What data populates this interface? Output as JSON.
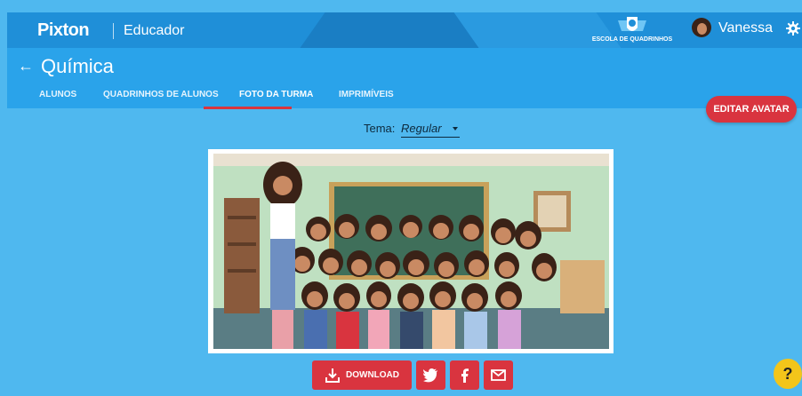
{
  "header": {
    "logo": "Pixton",
    "product": "Educador",
    "school_label": "ESCOLA DE QUADRINHOS",
    "user_name": "Vanessa"
  },
  "class": {
    "back_icon": "back-arrow-icon",
    "title": "Química"
  },
  "tabs": [
    {
      "label": "ALUNOS",
      "active": false
    },
    {
      "label": "QUADRINHOS DE ALUNOS",
      "active": false
    },
    {
      "label": "FOTO DA TURMA",
      "active": true
    },
    {
      "label": "IMPRIMÍVEIS",
      "active": false
    }
  ],
  "edit_avatar_label": "EDITAR AVATAR",
  "theme": {
    "label": "Tema:",
    "value": "Regular"
  },
  "actions": {
    "download_label": "DOWNLOAD",
    "share": [
      "twitter-icon",
      "facebook-icon",
      "email-icon"
    ]
  },
  "help_label": "?",
  "colors": {
    "page_bg": "#4fb8ef",
    "header_bg": "#1f8fd8",
    "accent_red": "#d9343f",
    "help_yellow": "#f3c51a"
  }
}
